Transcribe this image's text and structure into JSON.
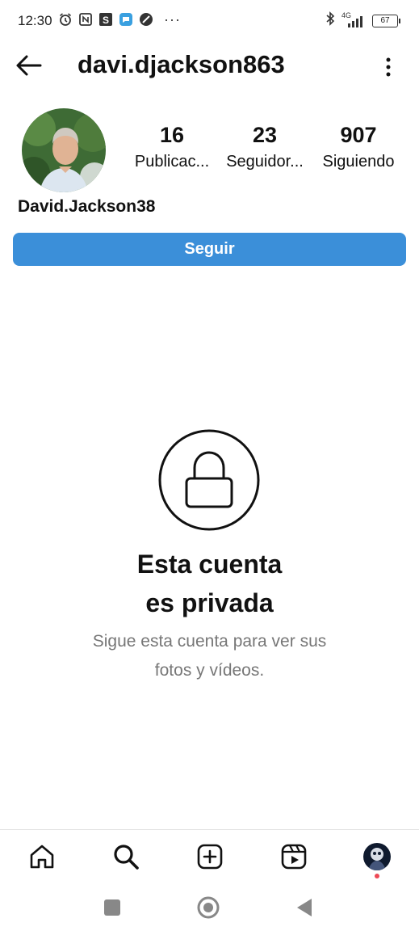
{
  "status_bar": {
    "time": "12:30",
    "network": "4G",
    "battery": "67",
    "more": "···"
  },
  "header": {
    "username": "davi.djackson863",
    "back_icon": "arrow-left-icon",
    "menu_icon": "more-vertical-icon"
  },
  "profile": {
    "display_name": "David.Jackson38",
    "stats": [
      {
        "value": "16",
        "label": "Publicac..."
      },
      {
        "value": "23",
        "label": "Seguidor..."
      },
      {
        "value": "907",
        "label": "Siguiendo"
      }
    ],
    "follow_label": "Seguir"
  },
  "private_notice": {
    "title_line1": "Esta cuenta",
    "title_line2": "es privada",
    "subtitle_line1": "Sigue esta cuenta para ver sus",
    "subtitle_line2": "fotos y vídeos."
  },
  "bottom_nav": {
    "items": [
      "home-icon",
      "search-icon",
      "add-post-icon",
      "reels-icon",
      "profile-avatar"
    ]
  },
  "colors": {
    "accent": "#3b8fd9",
    "notification_dot": "#ed4956",
    "subtext": "#777777"
  }
}
